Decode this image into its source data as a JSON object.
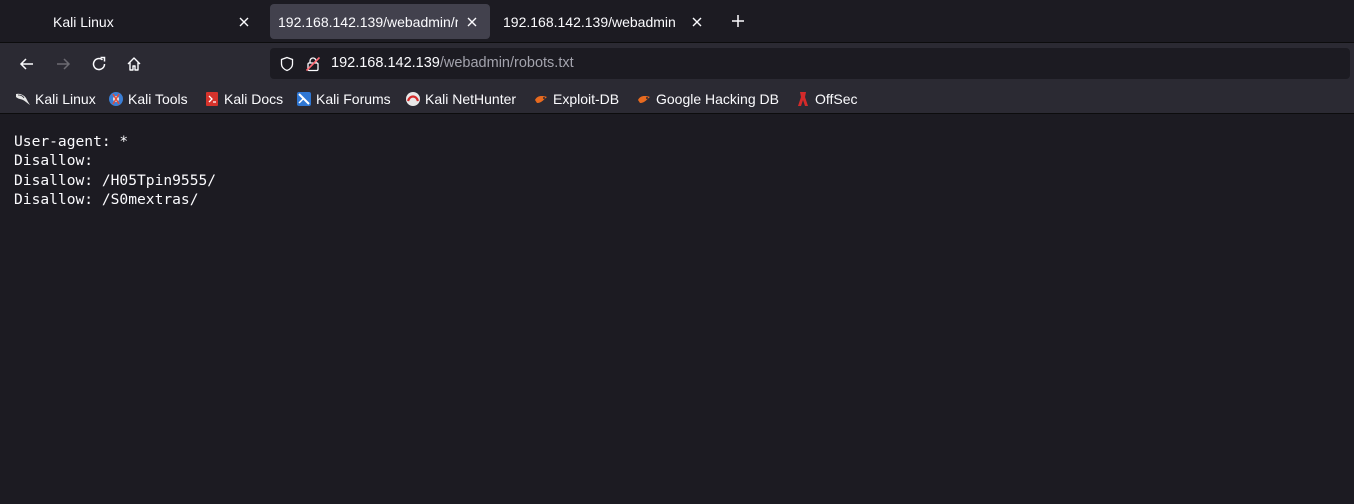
{
  "tabs": [
    {
      "label": "Kali Linux",
      "active": false
    },
    {
      "label": "192.168.142.139/webadmin/r",
      "active": true
    },
    {
      "label": "192.168.142.139/webadmin",
      "active": false
    }
  ],
  "navbar": {
    "url_host": "192.168.142.139",
    "url_path": "/webadmin/robots.txt"
  },
  "bookmarks": [
    {
      "label": "Kali Linux",
      "icon": "kali-dragon-icon"
    },
    {
      "label": "Kali Tools",
      "icon": "kali-tools-icon"
    },
    {
      "label": "Kali Docs",
      "icon": "kali-docs-icon"
    },
    {
      "label": "Kali Forums",
      "icon": "kali-forums-icon"
    },
    {
      "label": "Kali NetHunter",
      "icon": "nethunter-icon"
    },
    {
      "label": "Exploit-DB",
      "icon": "exploit-db-icon"
    },
    {
      "label": "Google Hacking DB",
      "icon": "ghdb-icon"
    },
    {
      "label": "OffSec",
      "icon": "offsec-icon"
    }
  ],
  "page": {
    "lines": [
      "User-agent: *",
      "Disallow:",
      "Disallow: /H05Tpin9555/",
      "Disallow: /S0mextras/"
    ]
  },
  "colors": {
    "background": "#1c1b22",
    "toolbar": "#2b2a33",
    "active_tab": "#42414d",
    "text": "#fbfbfe"
  }
}
